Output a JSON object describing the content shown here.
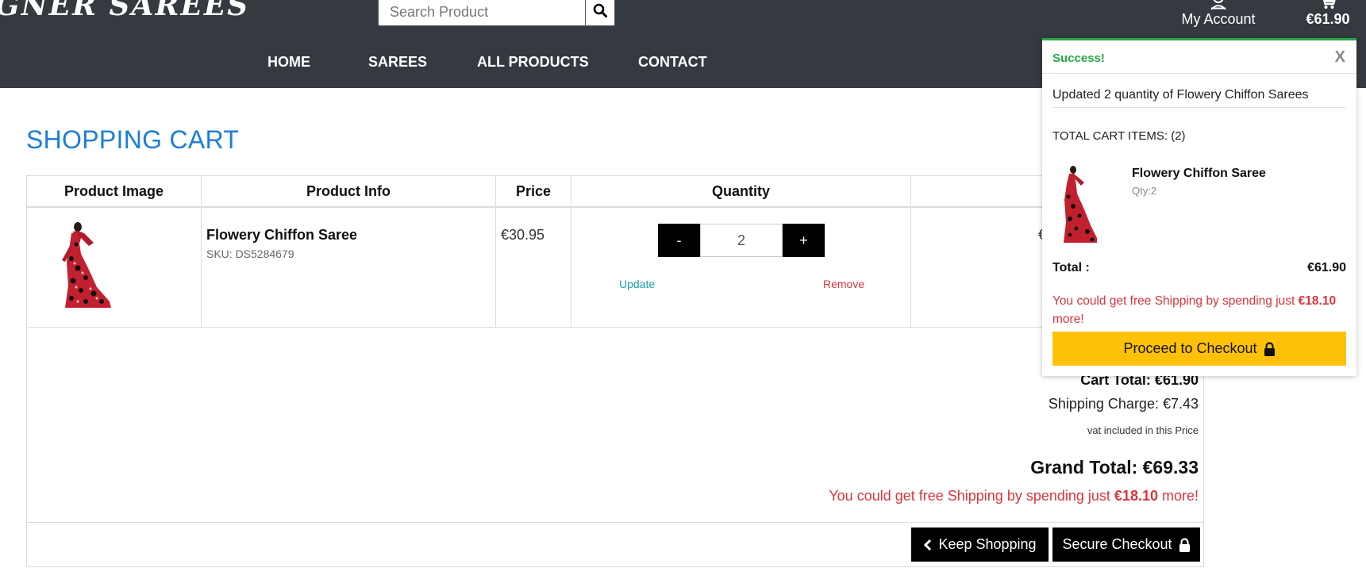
{
  "header": {
    "brand": "GNER SAREES",
    "search_placeholder": "Search Product",
    "account_label": "My Account",
    "cart_amount": "€61.90",
    "nav": [
      {
        "label": "HOME"
      },
      {
        "label": "SAREES"
      },
      {
        "label": "ALL PRODUCTS"
      },
      {
        "label": "CONTACT"
      }
    ]
  },
  "page": {
    "title": "SHOPPING CART"
  },
  "table": {
    "headers": [
      "Product Image",
      "Product Info",
      "Price",
      "Quantity",
      "Su"
    ],
    "row": {
      "name": "Flowery Chiffon Saree",
      "sku": "SKU: DS5284679",
      "price": "€30.95",
      "qty_minus": "-",
      "qty_value": "2",
      "qty_plus": "+",
      "update": "Update",
      "remove": "Remove",
      "subtotal_fragment": "€"
    }
  },
  "summary": {
    "cart_total": "Cart Total: €61.90",
    "shipping": "Shipping Charge: €7.43",
    "vat": "vat included in this Price",
    "grand_total": "Grand Total: €69.33",
    "free_prefix": "You could get free Shipping by spending just ",
    "free_amount": "€18.10",
    "free_suffix": " more!"
  },
  "actions": {
    "keep_shopping": "Keep Shopping",
    "secure_checkout": "Secure Checkout"
  },
  "popup": {
    "status": "Success!",
    "close": "X",
    "message": "Updated 2 quantity of Flowery Chiffon Sarees",
    "total_items": "TOTAL CART ITEMS: (2)",
    "item_name": "Flowery Chiffon Saree",
    "item_qty": "Qty:2",
    "total_label": "Total :",
    "total_value": "€61.90",
    "free_prefix": "You could get free Shipping by spending just ",
    "free_amount": "€18.10",
    "free_suffix": " more!",
    "checkout": "Proceed to Checkout"
  },
  "colors": {
    "header_bg": "#343a40",
    "title_blue": "#1b7fd6",
    "success_green": "#28a745",
    "alert_red": "#d9363e",
    "checkout_yellow": "#ffc107"
  }
}
